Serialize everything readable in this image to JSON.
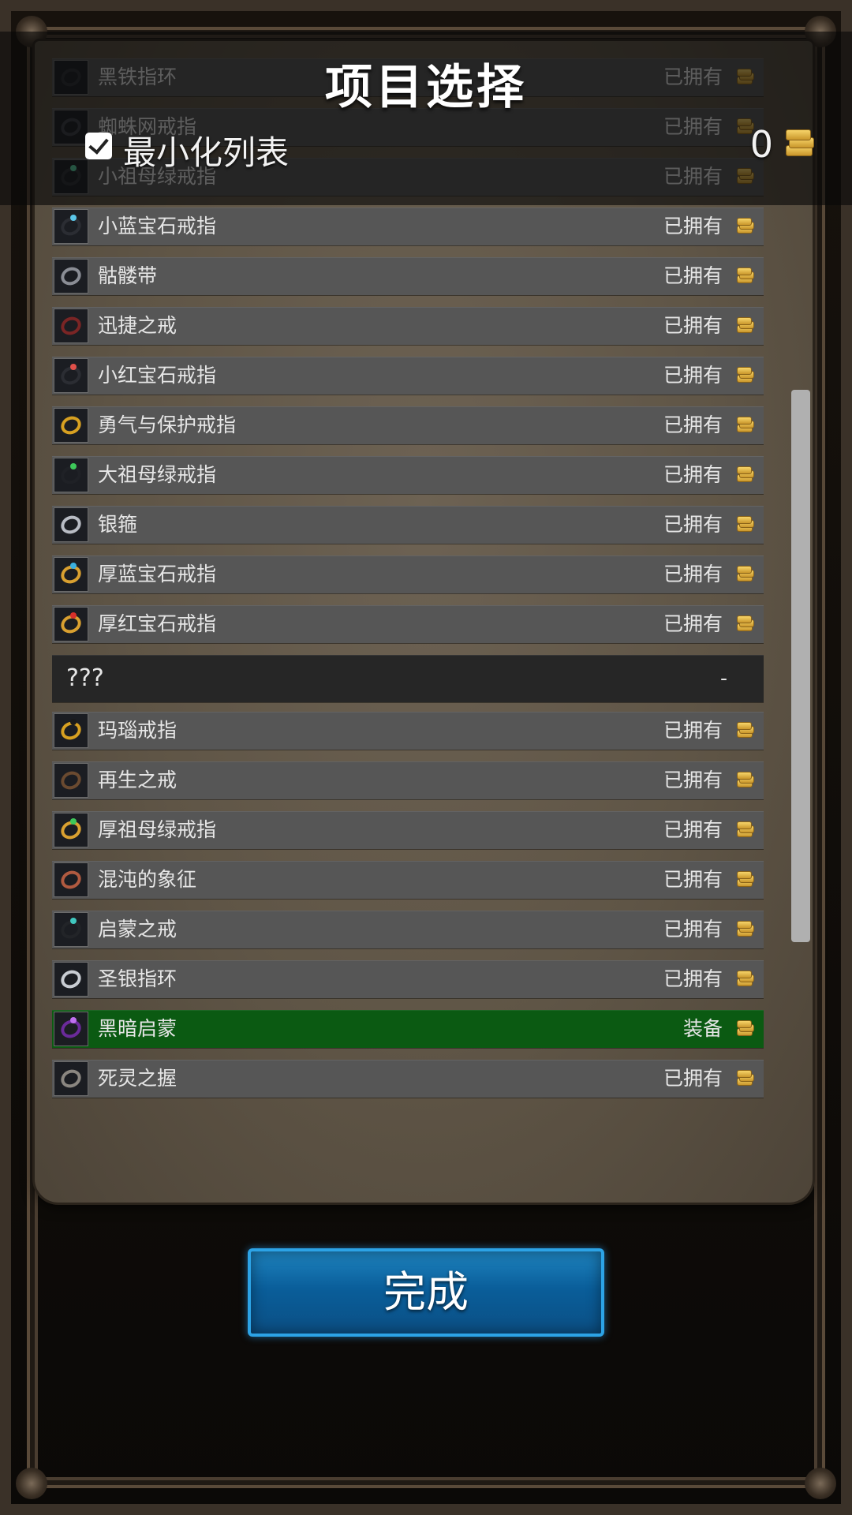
{
  "header": {
    "title": "项目选择",
    "minimize_label": "最小化列表",
    "minimize_checked": true,
    "gold_amount": "0",
    "gold_icon": "gold-coins-icon"
  },
  "items": [
    {
      "name": "黑铁指环",
      "status": "已拥有",
      "ring": "#2b2d33",
      "gem": ""
    },
    {
      "name": "蜘蛛网戒指",
      "status": "已拥有",
      "ring": "#3a3d45",
      "gem": ""
    },
    {
      "name": "小祖母绿戒指",
      "status": "已拥有",
      "ring": "#2b2d33",
      "gem": "#58d0a0"
    },
    {
      "name": "小蓝宝石戒指",
      "status": "已拥有",
      "ring": "#2b2d33",
      "gem": "#5bc6e8"
    },
    {
      "name": "骷髅带",
      "status": "已拥有",
      "ring": "#8a8d95",
      "gem": ""
    },
    {
      "name": "迅捷之戒",
      "status": "已拥有",
      "ring": "#7a2525",
      "gem": ""
    },
    {
      "name": "小红宝石戒指",
      "status": "已拥有",
      "ring": "#2b2d33",
      "gem": "#e0504a"
    },
    {
      "name": "勇气与保护戒指",
      "status": "已拥有",
      "ring": "#d7a021",
      "gem": ""
    },
    {
      "name": "大祖母绿戒指",
      "status": "已拥有",
      "ring": "#1f2126",
      "gem": "#3dc85a"
    },
    {
      "name": "银箍",
      "status": "已拥有",
      "ring": "#b8bcc4",
      "gem": ""
    },
    {
      "name": "厚蓝宝石戒指",
      "status": "已拥有",
      "ring": "#d9a030",
      "gem": "#3ab0e0"
    },
    {
      "name": "厚红宝石戒指",
      "status": "已拥有",
      "ring": "#d9a030",
      "gem": "#d8302a"
    },
    {
      "name": "???",
      "status": "-",
      "header": true
    },
    {
      "name": "玛瑙戒指",
      "status": "已拥有",
      "ring": "#d7a021",
      "gem": "#1a1a1a"
    },
    {
      "name": "再生之戒",
      "status": "已拥有",
      "ring": "#6a4a30",
      "gem": ""
    },
    {
      "name": "厚祖母绿戒指",
      "status": "已拥有",
      "ring": "#d9a030",
      "gem": "#3dc85a"
    },
    {
      "name": "混沌的象征",
      "status": "已拥有",
      "ring": "#b05a40",
      "gem": ""
    },
    {
      "name": "启蒙之戒",
      "status": "已拥有",
      "ring": "#222428",
      "gem": "#40c8c0"
    },
    {
      "name": "圣银指环",
      "status": "已拥有",
      "ring": "#c8ccd2",
      "gem": ""
    },
    {
      "name": "黑暗启蒙",
      "status": "装备",
      "ring": "#6a2a9a",
      "gem": "#c070f0",
      "equipped": true
    },
    {
      "name": "死灵之握",
      "status": "已拥有",
      "ring": "#8a8680",
      "gem": ""
    }
  ],
  "done_button": {
    "label": "完成"
  }
}
